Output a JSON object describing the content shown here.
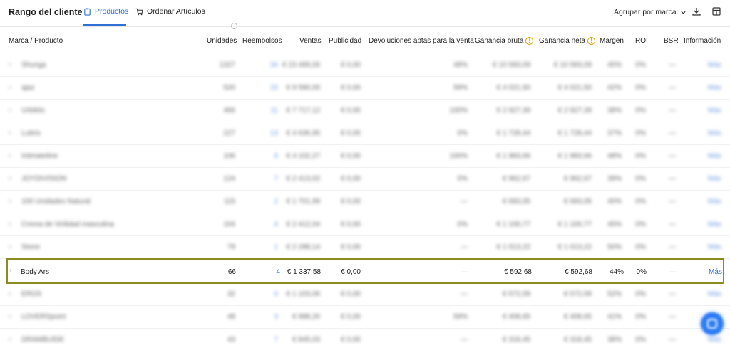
{
  "header": {
    "title": "Rango del cliente",
    "tabs": [
      {
        "label": "Productos",
        "active": true
      },
      {
        "label": "Ordenar Artículos",
        "active": false
      }
    ],
    "group_by": "Agrupar por marca"
  },
  "table": {
    "columns": {
      "product": "Marca / Producto",
      "units": "Unidades",
      "refunds": "Reembolsos",
      "sales": "Ventas",
      "ads": "Publicidad",
      "returns": "Devoluciones aptas para la venta",
      "gross": "Ganancia bruta",
      "net": "Ganancia neta",
      "margin": "Margen",
      "roi": "ROI",
      "bsr": "BSR",
      "info": "Información"
    },
    "blurred_rows": [
      {
        "name": "Shunga",
        "units": "1327",
        "refunds": "34",
        "sales": "€ 23 489,06",
        "ads": "€ 0,00",
        "returns": "48%",
        "gross": "€ 10 583,09",
        "net": "€ 10 583,09",
        "margin": "45%",
        "roi": "0%",
        "bsr": "—",
        "info": "Más"
      },
      {
        "name": "ajaz",
        "units": "520",
        "refunds": "15",
        "sales": "€ 9 580,00",
        "ads": "€ 0,00",
        "returns": "59%",
        "gross": "€ 4 021,50",
        "net": "€ 4 021,50",
        "margin": "42%",
        "roi": "0%",
        "bsr": "—",
        "info": "Más"
      },
      {
        "name": "Urbiktic",
        "units": "466",
        "refunds": "11",
        "sales": "€ 7 717,12",
        "ads": "€ 0,00",
        "returns": "100%",
        "gross": "€ 2 927,39",
        "net": "€ 2 927,39",
        "margin": "38%",
        "roi": "0%",
        "bsr": "—",
        "info": "Más"
      },
      {
        "name": "Lubrix",
        "units": "227",
        "refunds": "13",
        "sales": "€ 4 636,95",
        "ads": "€ 0,00",
        "returns": "0%",
        "gross": "€ 1 728,44",
        "net": "€ 1 728,44",
        "margin": "37%",
        "roi": "0%",
        "bsr": "—",
        "info": "Más"
      },
      {
        "name": "Intimateline",
        "units": "106",
        "refunds": "6",
        "sales": "€ 4 102,27",
        "ads": "€ 0,00",
        "returns": "100%",
        "gross": "€ 1 983,66",
        "net": "€ 1 983,66",
        "margin": "48%",
        "roi": "0%",
        "bsr": "—",
        "info": "Más"
      },
      {
        "name": "JOYDIVISION",
        "units": "124",
        "refunds": "7",
        "sales": "€ 2 413,02",
        "ads": "€ 0,00",
        "returns": "0%",
        "gross": "€ 962,67",
        "net": "€ 962,67",
        "margin": "39%",
        "roi": "0%",
        "bsr": "—",
        "info": "Más"
      },
      {
        "name": "100 Unidades Natural",
        "units": "115",
        "refunds": "2",
        "sales": "€ 1 701,99",
        "ads": "€ 0,00",
        "returns": "—",
        "gross": "€ 683,05",
        "net": "€ 683,05",
        "margin": "40%",
        "roi": "0%",
        "bsr": "—",
        "info": "Más"
      },
      {
        "name": "Crema de Virilidad masculina",
        "units": "104",
        "refunds": "4",
        "sales": "€ 2 412,04",
        "ads": "€ 0,00",
        "returns": "0%",
        "gross": "€ 1 100,77",
        "net": "€ 1 100,77",
        "margin": "45%",
        "roi": "0%",
        "bsr": "—",
        "info": "Más"
      },
      {
        "name": "Stone",
        "units": "79",
        "refunds": "1",
        "sales": "€ 2 288,14",
        "ads": "€ 0,00",
        "returns": "—",
        "gross": "€ 1 013,22",
        "net": "€ 1 013,22",
        "margin": "50%",
        "roi": "0%",
        "bsr": "—",
        "info": "Más"
      }
    ],
    "focus_row": {
      "name": "Body Ars",
      "units": "66",
      "refunds": "4",
      "sales": "€ 1 337,58",
      "ads": "€ 0,00",
      "returns": "—",
      "gross": "€ 592,68",
      "net": "€ 592,68",
      "margin": "44%",
      "roi": "0%",
      "bsr": "—",
      "info": "Más"
    },
    "blurred_rows_after": [
      {
        "name": "EROS",
        "units": "32",
        "refunds": "0",
        "sales": "€ 1 103,06",
        "ads": "€ 0,00",
        "returns": "—",
        "gross": "€ 572,09",
        "net": "€ 572,09",
        "margin": "52%",
        "roi": "0%",
        "bsr": "—",
        "info": "Más"
      },
      {
        "name": "LOVERSpoint",
        "units": "48",
        "refunds": "3",
        "sales": "€ 988,20",
        "ads": "€ 0,00",
        "returns": "59%",
        "gross": "€ 408,65",
        "net": "€ 408,65",
        "margin": "41%",
        "roi": "0%",
        "bsr": "—",
        "info": "Más"
      },
      {
        "name": "DRAMBUIDE",
        "units": "43",
        "refunds": "7",
        "sales": "€ 845,03",
        "ads": "€ 0,00",
        "returns": "—",
        "gross": "€ 318,45",
        "net": "€ 318,45",
        "margin": "38%",
        "roi": "0%",
        "bsr": "—",
        "info": "Más"
      }
    ]
  }
}
